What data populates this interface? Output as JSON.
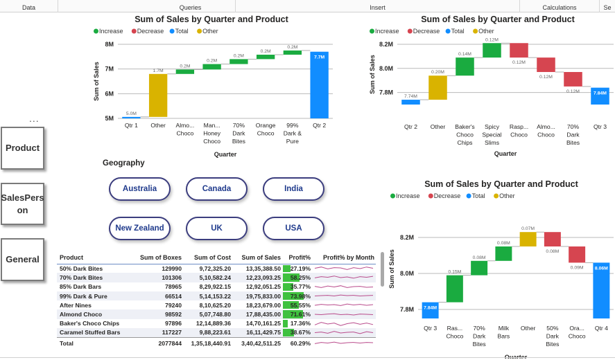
{
  "ribbon": {
    "groups": [
      "Data",
      "Queries",
      "Insert",
      "Calculations",
      "Se"
    ]
  },
  "nav": {
    "more_label": "...",
    "buttons": [
      {
        "label": "Product"
      },
      {
        "label": "SalesPers\non"
      },
      {
        "label": "General"
      }
    ]
  },
  "geography": {
    "title": "Geography",
    "options": [
      "Australia",
      "Canada",
      "India",
      "New Zealand",
      "UK",
      "USA"
    ]
  },
  "colors": {
    "increase": "#1aab40",
    "decrease": "#d64550",
    "total": "#118dff",
    "other": "#d9b300",
    "pill_border": "#3b3d7e",
    "profit_bar": "#3fc13f",
    "sparkline": "#b94a8b"
  },
  "chart_data": [
    {
      "type": "waterfall",
      "title": "Sum of Sales by Quarter and Product",
      "legend": [
        "Increase",
        "Decrease",
        "Total",
        "Other"
      ],
      "legend_position": "top-left",
      "xlabel": "Quarter",
      "ylabel": "Sum of Sales",
      "ylim": [
        5,
        8
      ],
      "yticks": [
        "5M",
        "6M",
        "7M",
        "8M"
      ],
      "grid": true,
      "categories": [
        "Qtr 1",
        "Other",
        "Almo... Choco",
        "Man... Honey Choco",
        "70% Dark Bites",
        "Orange Choco",
        "99% Dark & Pure",
        "Qtr 2"
      ],
      "bars": [
        {
          "kind": "total",
          "start": 5.0,
          "end": 5.06,
          "label": "5.0M"
        },
        {
          "kind": "other",
          "start": 5.06,
          "end": 6.8,
          "label": "1.7M"
        },
        {
          "kind": "increase",
          "start": 6.8,
          "end": 6.98,
          "label": "0.2M"
        },
        {
          "kind": "increase",
          "start": 6.98,
          "end": 7.2,
          "label": "0.2M"
        },
        {
          "kind": "increase",
          "start": 7.2,
          "end": 7.4,
          "label": "0.2M"
        },
        {
          "kind": "increase",
          "start": 7.4,
          "end": 7.58,
          "label": "0.2M"
        },
        {
          "kind": "increase",
          "start": 7.58,
          "end": 7.75,
          "label": "0.2M"
        },
        {
          "kind": "total",
          "start": 5.0,
          "end": 7.7,
          "label": "7.7M"
        }
      ]
    },
    {
      "type": "waterfall",
      "title": "Sum of Sales by Quarter and Product",
      "legend": [
        "Increase",
        "Decrease",
        "Total",
        "Other"
      ],
      "legend_position": "top-left",
      "xlabel": "Quarter",
      "ylabel": "Sum of Sales",
      "ylim": [
        7.7,
        8.2
      ],
      "yticks": [
        "7.8M",
        "8.0M",
        "8.2M"
      ],
      "grid": true,
      "categories": [
        "Qtr 2",
        "Other",
        "Baker's Choco Chips",
        "Spicy Special Slims",
        "Rasp... Choco",
        "Almo... Choco",
        "70% Dark Bites",
        "Qtr 3"
      ],
      "bars": [
        {
          "kind": "total",
          "start": 7.7,
          "end": 7.74,
          "label": "7.74M"
        },
        {
          "kind": "other",
          "start": 7.74,
          "end": 7.94,
          "label": "0.20M"
        },
        {
          "kind": "increase",
          "start": 7.94,
          "end": 8.09,
          "label": "0.14M"
        },
        {
          "kind": "increase",
          "start": 8.09,
          "end": 8.21,
          "label": "0.12M"
        },
        {
          "kind": "decrease",
          "start": 8.21,
          "end": 8.09,
          "label": "0.12M"
        },
        {
          "kind": "decrease",
          "start": 8.09,
          "end": 7.97,
          "label": "0.12M"
        },
        {
          "kind": "decrease",
          "start": 7.97,
          "end": 7.85,
          "label": "0.12M"
        },
        {
          "kind": "total",
          "start": 7.7,
          "end": 7.84,
          "label": "7.84M"
        }
      ]
    },
    {
      "type": "waterfall",
      "title": "Sum of Sales by Quarter and Product",
      "legend": [
        "Increase",
        "Decrease",
        "Total",
        "Other"
      ],
      "legend_position": "top-left",
      "xlabel": "Quarter",
      "ylabel": "Sum of Sales",
      "ylim": [
        7.75,
        8.3
      ],
      "yticks": [
        "7.8M",
        "8.0M",
        "8.2M"
      ],
      "grid": true,
      "categories": [
        "Qtr 3",
        "Ras... Choco",
        "70% Dark Bites",
        "Milk Bars",
        "Other",
        "50% Dark Bites",
        "Ora... Choco",
        "Qtr 4"
      ],
      "bars": [
        {
          "kind": "total",
          "start": 7.75,
          "end": 7.84,
          "label": "7.84M"
        },
        {
          "kind": "increase",
          "start": 7.84,
          "end": 7.99,
          "label": "0.15M"
        },
        {
          "kind": "increase",
          "start": 7.99,
          "end": 8.07,
          "label": "0.08M"
        },
        {
          "kind": "increase",
          "start": 8.07,
          "end": 8.15,
          "label": "0.08M"
        },
        {
          "kind": "other",
          "start": 8.15,
          "end": 8.23,
          "label": "0.07M"
        },
        {
          "kind": "decrease",
          "start": 8.23,
          "end": 8.15,
          "label": "0.08M"
        },
        {
          "kind": "decrease",
          "start": 8.15,
          "end": 8.06,
          "label": "0.09M"
        },
        {
          "kind": "total",
          "start": 7.75,
          "end": 8.06,
          "label": "8.06M"
        }
      ]
    }
  ],
  "table": {
    "headers": [
      "Product",
      "Sum of Boxes",
      "Sum of Cost",
      "Sum of Sales",
      "Profit%",
      "Profit% by Month"
    ],
    "rows": [
      {
        "product": "50% Dark Bites",
        "boxes": "129990",
        "cost": "9,72,325.20",
        "sales": "13,35,388.50",
        "profit": "27.19%",
        "profit_value": 27.19,
        "spark": [
          0.5,
          0.7,
          0.4,
          0.6,
          0.55,
          0.3,
          0.6,
          0.45,
          0.7,
          0.5
        ]
      },
      {
        "product": "70% Dark Bites",
        "boxes": "101306",
        "cost": "5,10,582.24",
        "sales": "12,23,093.25",
        "profit": "58.25%",
        "profit_value": 58.25,
        "spark": [
          0.4,
          0.6,
          0.5,
          0.7,
          0.45,
          0.55,
          0.35,
          0.6,
          0.5,
          0.65
        ]
      },
      {
        "product": "85% Dark Bars",
        "boxes": "78965",
        "cost": "8,29,922.15",
        "sales": "12,92,051.25",
        "profit": "35.77%",
        "profit_value": 35.77,
        "spark": [
          0.6,
          0.4,
          0.65,
          0.5,
          0.7,
          0.4,
          0.55,
          0.6,
          0.45,
          0.5
        ]
      },
      {
        "product": "99% Dark & Pure",
        "boxes": "66514",
        "cost": "5,14,153.22",
        "sales": "19,75,833.00",
        "profit": "73.98%",
        "profit_value": 73.98,
        "spark": [
          0.5,
          0.55,
          0.6,
          0.5,
          0.65,
          0.55,
          0.6,
          0.5,
          0.55,
          0.6
        ]
      },
      {
        "product": "After Nines",
        "boxes": "79240",
        "cost": "8,10,625.20",
        "sales": "18,23,679.00",
        "profit": "55.55%",
        "profit_value": 55.55,
        "spark": [
          0.45,
          0.6,
          0.5,
          0.55,
          0.4,
          0.65,
          0.5,
          0.6,
          0.45,
          0.55
        ]
      },
      {
        "product": "Almond Choco",
        "boxes": "98592",
        "cost": "5,07,748.80",
        "sales": "17,88,435.00",
        "profit": "71.61%",
        "profit_value": 71.61,
        "spark": [
          0.55,
          0.5,
          0.6,
          0.65,
          0.5,
          0.55,
          0.45,
          0.6,
          0.55,
          0.5
        ]
      },
      {
        "product": "Baker's Choco Chips",
        "boxes": "97896",
        "cost": "12,14,889.36",
        "sales": "14,70,161.25",
        "profit": "17.36%",
        "profit_value": 17.36,
        "spark": [
          0.3,
          0.7,
          0.45,
          0.6,
          0.2,
          0.5,
          0.65,
          0.4,
          0.6,
          0.35
        ]
      },
      {
        "product": "Caramel Stuffed Bars",
        "boxes": "117227",
        "cost": "9,88,223.61",
        "sales": "16,11,429.75",
        "profit": "38.67%",
        "profit_value": 38.67,
        "spark": [
          0.5,
          0.6,
          0.4,
          0.7,
          0.45,
          0.55,
          0.6,
          0.35,
          0.65,
          0.5
        ]
      }
    ],
    "total": {
      "label": "Total",
      "boxes": "2077844",
      "cost": "1,35,18,440.91",
      "sales": "3,40,42,511.25",
      "profit": "60.29%",
      "spark": [
        0.4,
        0.6,
        0.5,
        0.65,
        0.45,
        0.55,
        0.6,
        0.5,
        0.6,
        0.55
      ]
    }
  }
}
